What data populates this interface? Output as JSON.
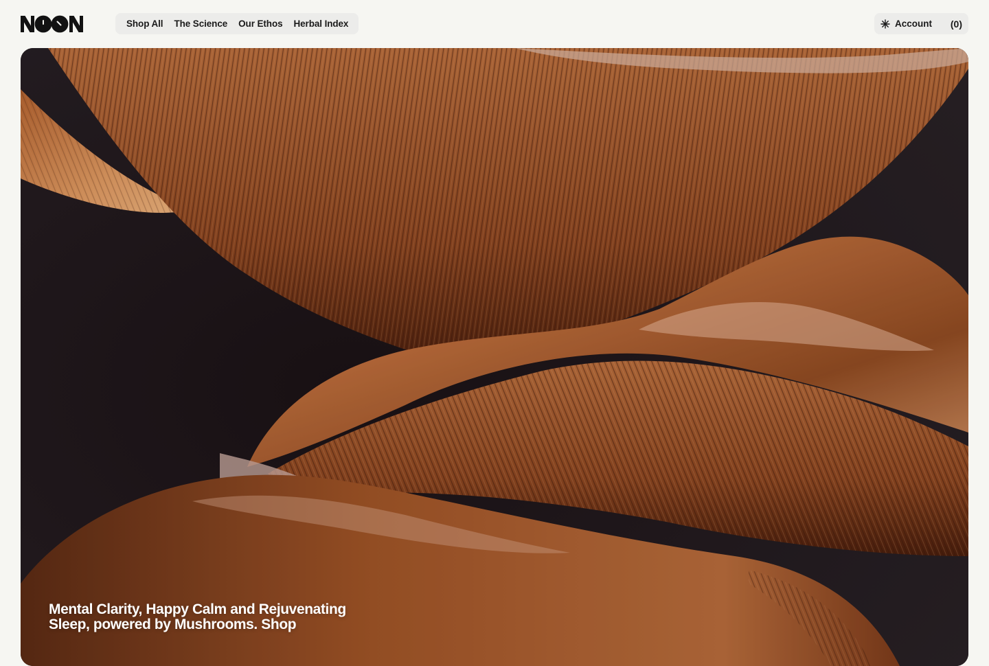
{
  "brand": {
    "logo_text": "NOON"
  },
  "nav": {
    "items": [
      {
        "label": "Shop All"
      },
      {
        "label": "The Science"
      },
      {
        "label": "Our Ethos"
      },
      {
        "label": "Herbal Index"
      }
    ]
  },
  "account": {
    "label": "Account",
    "icon": "asterisk-spark-icon",
    "cart_count": "(0)"
  },
  "hero": {
    "image": "close-up-mushroom-gills-photo",
    "caption": "Mental Clarity, Happy Calm and Rejuvenating Sleep, powered by Mushrooms. Shop"
  },
  "colors": {
    "background": "#f6f6f2",
    "pill_background": "#ececea",
    "text": "#1a1a1a",
    "hero_dark": "#1d1518",
    "mushroom_brown": "#8a4a24"
  }
}
